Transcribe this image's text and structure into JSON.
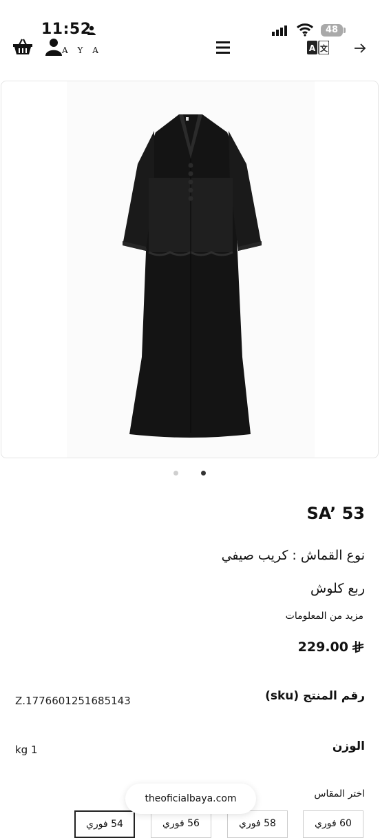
{
  "status_bar": {
    "time": "11:52",
    "battery": "48"
  },
  "header": {
    "logo_text": "A Y A"
  },
  "icons": {
    "basket": "basket-icon",
    "user": "user-icon",
    "menu": "hamburger-menu-icon",
    "translate": "translate-icon",
    "forward": "arrow-right-icon"
  },
  "gallery": {
    "slide_count": 2,
    "active_slide": 2
  },
  "product": {
    "title": "SA’ 53",
    "fabric": "نوع القماش : كريب صيفي",
    "fit": "ربع كلوش",
    "more_info": "مزيد من المعلومات",
    "price": "229.00",
    "currency_symbol": "⃁",
    "sku_label": "رقم المنتج (sku)",
    "sku_value": "Z.1776601251685143",
    "weight_label": "الوزن",
    "weight_value": "kg 1",
    "size_label": "اختر المقاس",
    "sizes": [
      "60 فوري",
      "58 فوري",
      "56 فوري",
      "54 فوري"
    ],
    "selected_size": "54 فوري"
  },
  "browser": {
    "url": "theoficialbaya.com"
  },
  "colors": {
    "text": "#111111",
    "garment": "#141414",
    "border": "#e4e4e4"
  }
}
